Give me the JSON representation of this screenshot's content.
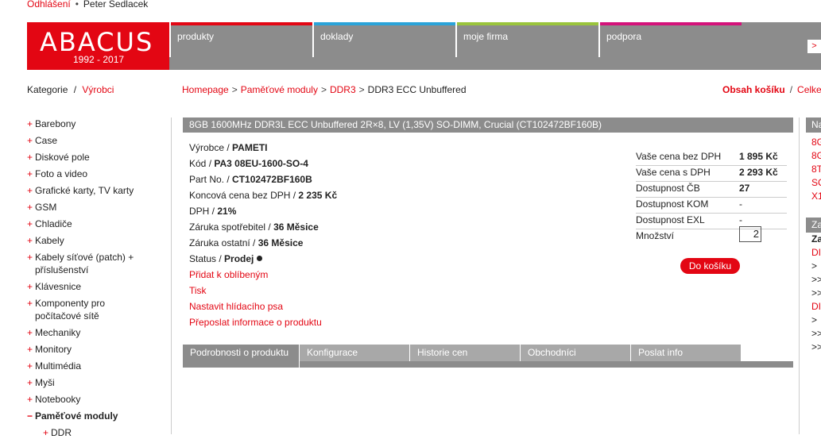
{
  "top": {
    "logout": "Odhlášení",
    "user": "Peter Sedlacek"
  },
  "logo": {
    "name": "ABACUS",
    "years": "1992 - 2017"
  },
  "nav": [
    {
      "label": "produkty",
      "color": "#e30613"
    },
    {
      "label": "doklady",
      "color": "#2aa3d9"
    },
    {
      "label": "moje firma",
      "color": "#9ac43c"
    },
    {
      "label": "podpora",
      "color": "#d4127a"
    }
  ],
  "nav_arrow": ">",
  "cats": {
    "kategorie": "Kategorie",
    "vyrobci": "Výrobci"
  },
  "breadcrumb": {
    "home": "Homepage",
    "mem": "Paměťové moduly",
    "ddr3": "DDR3",
    "current": "DDR3 ECC Unbuffered"
  },
  "cart": {
    "label": "Obsah košíku",
    "total": "Celke"
  },
  "sidebar": {
    "items": [
      "Barebony",
      "Case",
      "Diskové pole",
      "Foto a video",
      "Grafické karty, TV karty",
      "GSM",
      "Chladiče",
      "Kabely",
      "Kabely síťové (patch) + příslušenství",
      "Klávesnice",
      "Komponenty pro počítačové sítě",
      "Mechaniky",
      "Monitory",
      "Multimédia",
      "Myši",
      "Notebooky"
    ],
    "active": "Paměťové moduly",
    "sub": "DDR"
  },
  "product": {
    "title": "8GB 1600MHz DDR3L ECC Unbuffered 2R×8, LV (1,35V) SO-DIMM, Crucial (CT102472BF160B)",
    "vyrobce_l": "Výrobce",
    "vyrobce": "PAMETI",
    "kod_l": "Kód",
    "kod": "PA3 08EU-1600-SO-4",
    "part_l": "Part No.",
    "part": "CT102472BF160B",
    "koncova_l": "Koncová cena bez DPH",
    "koncova": "2 235 Kč",
    "dph_l": "DPH",
    "dph": "21%",
    "zaruka_s_l": "Záruka spotřebitel",
    "zaruka_s": "36 Měsice",
    "zaruka_o_l": "Záruka ostatní",
    "zaruka_o": "36 Měsice",
    "status_l": "Status",
    "status": "Prodej",
    "links": [
      "Přidat k oblíbeným",
      "Tisk",
      "Nastavit hlídacího psa",
      "Přeposlat informace o produktu"
    ]
  },
  "price": {
    "bez_l": "Vaše cena bez DPH",
    "bez": "1 895 Kč",
    "s_l": "Vaše cena s DPH",
    "s": "2 293 Kč",
    "cb_l": "Dostupnost ČB",
    "cb": "27",
    "kom_l": "Dostupnost KOM",
    "kom": "-",
    "exl_l": "Dostupnost EXL",
    "exl": "-",
    "qty_l": "Množství",
    "qty": "2",
    "add": "Do košíku"
  },
  "tabs": [
    "Podrobnosti o produktu",
    "Konfigurace",
    "Historie cen",
    "Obchodníci",
    "Poslat info"
  ],
  "right": {
    "bar1": "Na",
    "lines1": [
      "8G",
      "8G",
      "8T",
      "SC",
      "X1"
    ],
    "bar2": "Za",
    "lines2": [
      "Za",
      "DI",
      ">",
      ">>",
      ">>",
      "DI",
      ">",
      ">>",
      ">>"
    ]
  }
}
